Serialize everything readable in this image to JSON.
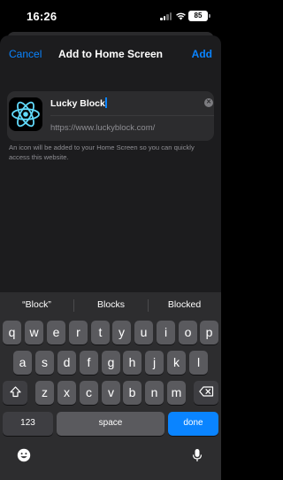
{
  "status": {
    "time": "16:26",
    "battery": "85"
  },
  "nav": {
    "cancel": "Cancel",
    "title": "Add to Home Screen",
    "add": "Add"
  },
  "shortcut": {
    "name_value": "Lucky Block",
    "url": "https://www.luckyblock.com/",
    "info": "An icon will be added to your Home Screen so you can quickly access this website."
  },
  "keyboard": {
    "suggestions": [
      "“Block”",
      "Blocks",
      "Blocked"
    ],
    "row1": [
      "q",
      "w",
      "e",
      "r",
      "t",
      "y",
      "u",
      "i",
      "o",
      "p"
    ],
    "row2": [
      "a",
      "s",
      "d",
      "f",
      "g",
      "h",
      "j",
      "k",
      "l"
    ],
    "row3": [
      "z",
      "x",
      "c",
      "v",
      "b",
      "n",
      "m"
    ],
    "numbers_label": "123",
    "space_label": "space",
    "done_label": "done"
  },
  "colors": {
    "accent": "#0a84ff",
    "sheet": "#1c1c1e",
    "field": "#2c2c2e",
    "keyboard": "#2d2d2f",
    "key": "#5a5a5e"
  }
}
